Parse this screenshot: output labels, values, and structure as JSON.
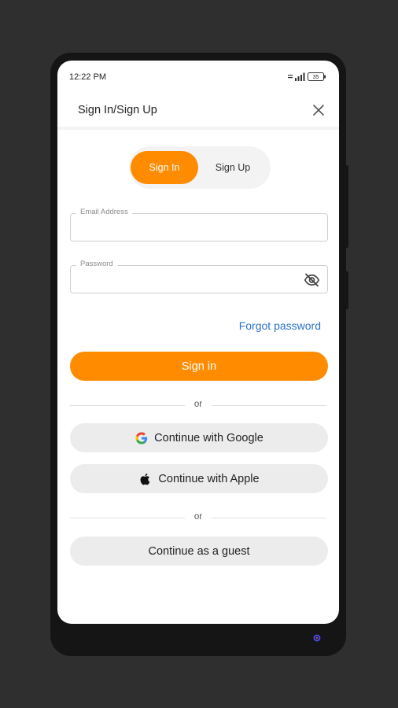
{
  "status_bar": {
    "time": "12:22 PM",
    "battery": "35"
  },
  "header": {
    "title": "Sign In/Sign Up",
    "close_icon": "close-icon"
  },
  "auth_tabs": {
    "sign_in_label": "Sign In",
    "sign_up_label": "Sign Up",
    "active": "Sign In"
  },
  "form": {
    "email_label": "Email Address",
    "email_value": "",
    "password_label": "Password",
    "password_value": "",
    "password_toggle_icon": "eye-off-icon",
    "forgot_label": "Forgot password",
    "submit_label": "Sign in"
  },
  "dividers": {
    "first": "or",
    "second": "or"
  },
  "social": {
    "google_label": "Continue with Google",
    "apple_label": "Continue with Apple",
    "google_icon": "google-icon",
    "apple_icon": "apple-icon"
  },
  "guest": {
    "label": "Continue as a guest"
  },
  "colors": {
    "accent": "#ff8c00",
    "link": "#2f73c9",
    "secondary_button": "#ececec",
    "frame_background": "#2f2f2f"
  }
}
